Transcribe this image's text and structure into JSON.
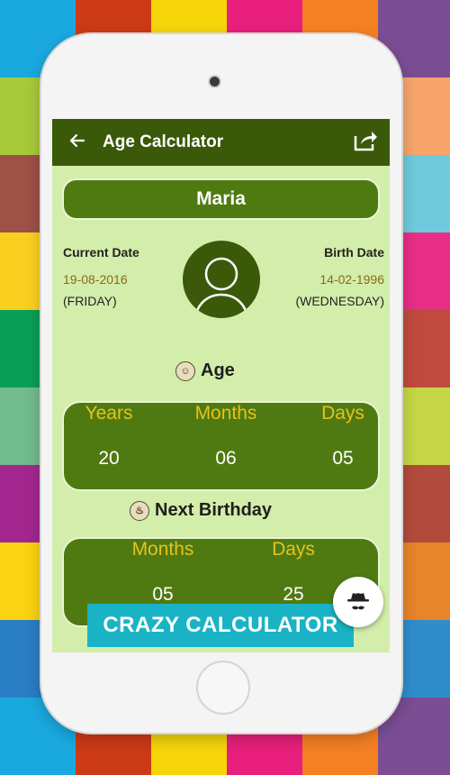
{
  "background_tiles": [
    "#1aa9df",
    "#cc3a16",
    "#f6d50b",
    "#e81f7c",
    "#f57f23",
    "#7b4d94",
    "#a8c93a",
    "#f26c2a",
    "#f8f8f8",
    "#f8f8f8",
    "#f8f8f8",
    "#f7a56b",
    "#9e5147",
    "#2e7cc3",
    "#f8f8f8",
    "#f8f8f8",
    "#f8f8f8",
    "#6fcadd",
    "#f9d020",
    "#7bc143",
    "#f8f8f8",
    "#f8f8f8",
    "#f8f8f8",
    "#e82e86",
    "#0a9f57",
    "#f1742c",
    "#f8f8f8",
    "#f8f8f8",
    "#f8f8f8",
    "#bf4a3d",
    "#72bc8d",
    "#f9b41f",
    "#f8f8f8",
    "#f8f8f8",
    "#f8f8f8",
    "#c5d745",
    "#a4278f",
    "#9b4b90",
    "#f8f8f8",
    "#f8f8f8",
    "#f8f8f8",
    "#b34b3c",
    "#fbd311",
    "#27a34e",
    "#f8f8f8",
    "#f8f8f8",
    "#f8f8f8",
    "#e8842a",
    "#2a7ec4",
    "#d32f2f",
    "#f8f8f8",
    "#f8f8f8",
    "#f8f8f8",
    "#2f8dcc",
    "#1aa9df",
    "#cc3a16",
    "#f6d50b",
    "#e81f7c",
    "#f57f23",
    "#7b4d94"
  ],
  "appbar": {
    "title": "Age Calculator",
    "back_icon": "arrow-left-icon",
    "share_icon": "share-icon"
  },
  "name": "Maria",
  "current_date": {
    "label": "Current Date",
    "value": "19-08-2016",
    "weekday": "(FRIDAY)"
  },
  "birth_date": {
    "label": "Birth Date",
    "value": "14-02-1996",
    "weekday": "(WEDNESDAY)"
  },
  "age": {
    "title": "Age",
    "columns": [
      {
        "header": "Years",
        "value": "20"
      },
      {
        "header": "Months",
        "value": "06"
      },
      {
        "header": "Days",
        "value": "05"
      }
    ]
  },
  "next_birthday": {
    "title": "Next Birthday",
    "columns": [
      {
        "header": "Months",
        "value": "05"
      },
      {
        "header": "Days",
        "value": "25"
      }
    ]
  },
  "banner": {
    "label": "CRAZY CALCULATOR"
  },
  "colors": {
    "appbar": "#3a5a0a",
    "panel": "#4f7a12",
    "screen_bg": "#d3edaa",
    "header_text": "#e7c21a",
    "banner": "#1ab3c5"
  }
}
